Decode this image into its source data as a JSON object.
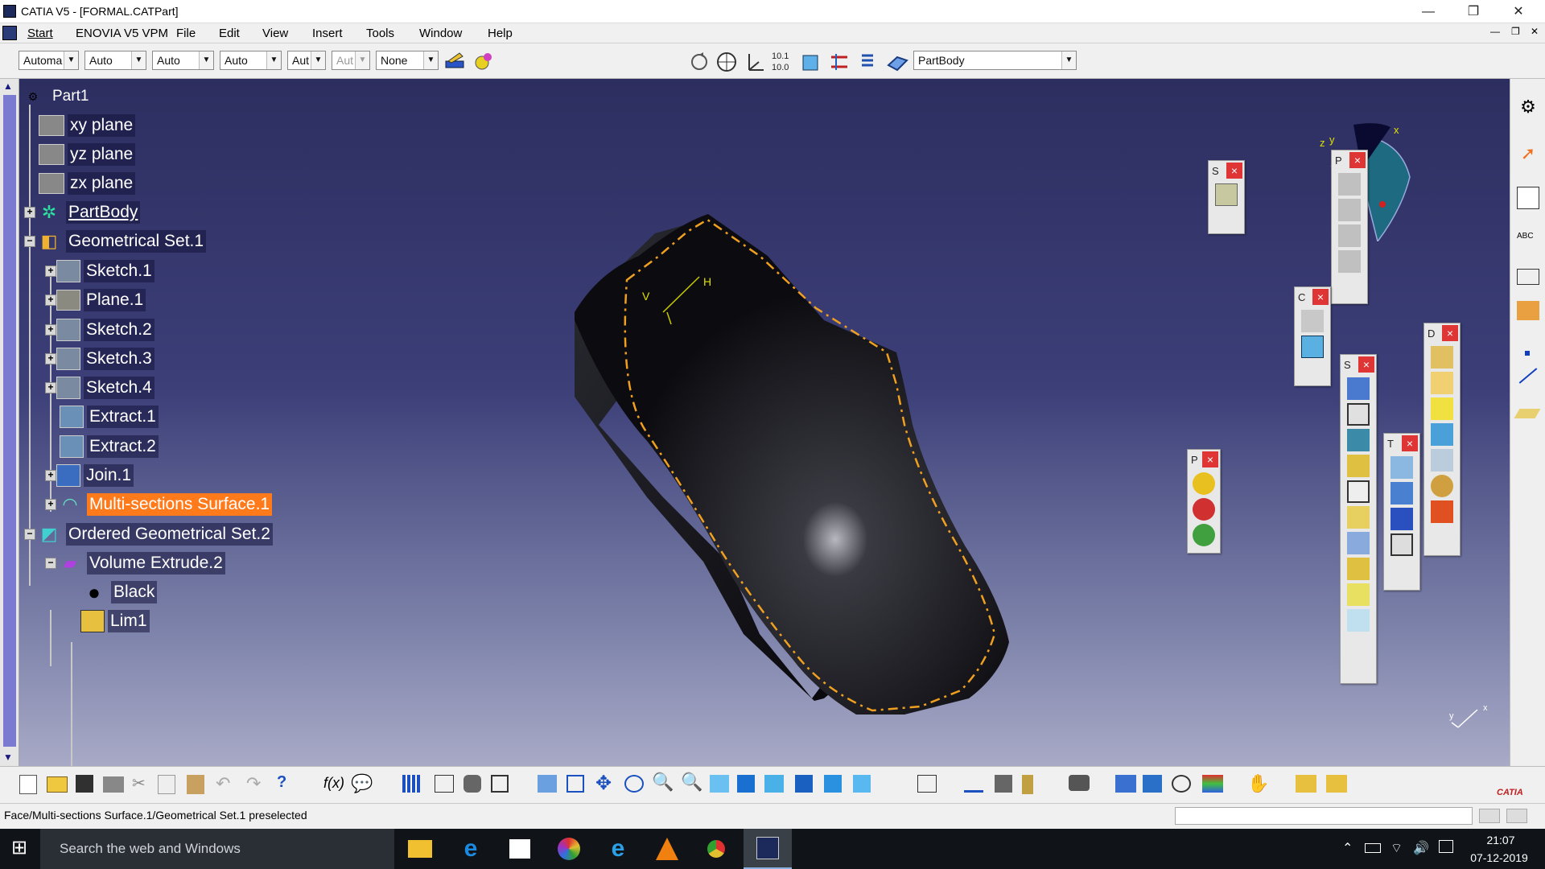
{
  "window": {
    "title": "CATIA V5 - [FORMAL.CATPart]"
  },
  "menubar": {
    "items": [
      "Start",
      "ENOVIA V5 VPM",
      "File",
      "Edit",
      "View",
      "Insert",
      "Tools",
      "Window",
      "Help"
    ]
  },
  "toolbar_top": {
    "combos": [
      "Automa",
      "Auto",
      "Auto",
      "Auto",
      "Aut",
      "Aut",
      "None"
    ],
    "body_select": "PartBody"
  },
  "tree": {
    "root": "Part1",
    "items": [
      "xy plane",
      "yz plane",
      "zx plane",
      "PartBody",
      "Geometrical Set.1",
      "Sketch.1",
      "Plane.1",
      "Sketch.2",
      "Sketch.3",
      "Sketch.4",
      "Extract.1",
      "Extract.2",
      "Join.1",
      "Multi-sections Surface.1",
      "Ordered Geometrical Set.2",
      "Volume Extrude.2",
      "Black",
      "Lim1"
    ]
  },
  "compass": {
    "x": "x",
    "y": "y",
    "z": "z"
  },
  "sketch_axes": {
    "v": "V",
    "h": "H"
  },
  "mini_axes": {
    "y": "y",
    "x": "x"
  },
  "palettes": {
    "p1": "S",
    "p2": "P",
    "p3": "C",
    "p4": "S",
    "p5": "D",
    "p6": "T",
    "p7": "P"
  },
  "close_glyph": "×",
  "status": {
    "message": "Face/Multi-sections Surface.1/Geometrical Set.1 preselected"
  },
  "taskbar": {
    "search_placeholder": "Search the web and Windows",
    "time": "21:07",
    "date": "07-12-2019"
  },
  "brand": {
    "logo": "CATIA"
  },
  "colors": {
    "selection": "#ff7a1a",
    "viewport_top": "#2d2e60",
    "viewport_bottom": "#a8aac6",
    "edge_dash": "#f0a020",
    "close": "#e03535"
  }
}
